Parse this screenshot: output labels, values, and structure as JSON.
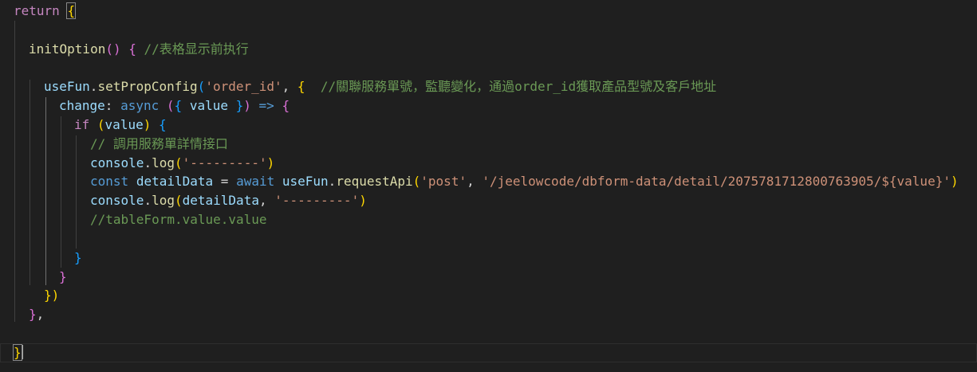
{
  "editor": {
    "line_return": {
      "keyword": "return",
      "brace": "{"
    },
    "line_init": {
      "name": "initOption",
      "parens": "()",
      "brace": "{",
      "comment": "//表格显示前执行"
    },
    "line_setprop": {
      "obj": "useFun",
      "method": "setPropConfig",
      "paren": "(",
      "arg": "'order_id'",
      "comma": ",",
      "brace": "{",
      "comment": "//關聯服務單號，監聽變化，通過order_id獲取產品型號及客戶地址"
    },
    "line_change": {
      "key": "change",
      "colon": ":",
      "async": "async",
      "paren": "(",
      "brace_open": "{",
      "param": "value",
      "brace_close": "}",
      "paren_close": ")",
      "arrow": "=>",
      "brace": "{"
    },
    "line_if": {
      "keyword": "if",
      "paren": "(",
      "cond": "value",
      "paren_close": ")",
      "brace": "{"
    },
    "line_cmt": {
      "comment": "// 調用服務單詳情接口"
    },
    "line_log1": {
      "obj": "console",
      "method": "log",
      "paren": "(",
      "arg": "'---------'",
      "paren_close": ")"
    },
    "line_const": {
      "keyword": "const",
      "name": "detailData",
      "eq": "=",
      "await": "await",
      "obj": "useFun",
      "method": "requestApi",
      "paren": "(",
      "arg1": "'post'",
      "comma": ",",
      "arg2": "'/jeelowcode/dbform-data/detail/2075781712800763905/${value}'",
      "paren_close": ")"
    },
    "line_log2": {
      "obj": "console",
      "method": "log",
      "paren": "(",
      "arg1": "detailData",
      "comma": ",",
      "arg2": "'---------'",
      "paren_close": ")"
    },
    "line_cmt2": {
      "comment": "//tableForm.value.value"
    },
    "line_close_if": {
      "brace": "}"
    },
    "line_close_change": {
      "brace": "}"
    },
    "line_close_setprop": {
      "brace": "})"
    },
    "line_close_init": {
      "brace": "}",
      "comma": ","
    },
    "line_close_return": {
      "brace": "}"
    }
  }
}
